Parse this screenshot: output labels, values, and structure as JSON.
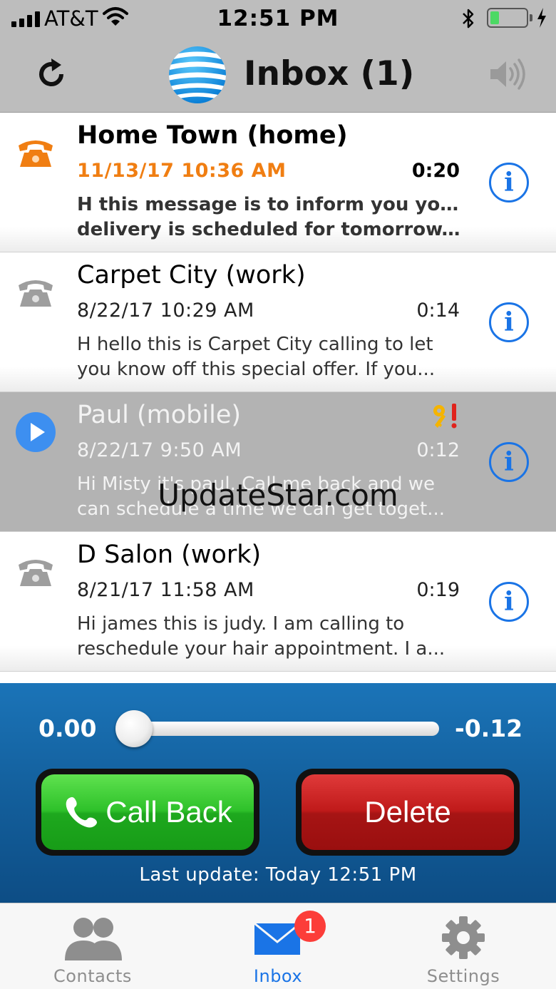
{
  "status_bar": {
    "carrier": "AT&T",
    "time": "12:51 PM"
  },
  "header": {
    "title": "Inbox (1)"
  },
  "messages": [
    {
      "name": "Home Town (home)",
      "date": "11/13/17 10:36 AM",
      "duration": "0:20",
      "preview_line1": "H this message is to inform you your",
      "preview_line2": "delivery is scheduled for tomorrow...",
      "unread": true,
      "icon": "phone-orange-icon"
    },
    {
      "name": "Carpet City (work)",
      "date": "8/22/17 10:29 AM",
      "duration": "0:14",
      "preview_line1": "H hello this is Carpet City calling to let",
      "preview_line2": "you know off this special offer. If you...",
      "unread": false,
      "icon": "phone-gray-icon"
    },
    {
      "name": "Paul (mobile)",
      "date": "8/22/17 9:50 AM",
      "duration": "0:12",
      "preview_line1": "Hi Misty it's paul. Call me back and we",
      "preview_line2": "can schedule a time we can get toget...",
      "unread": false,
      "selected": true,
      "icon": "play-icon"
    },
    {
      "name": "D Salon (work)",
      "date": "8/21/17 11:58 AM",
      "duration": "0:19",
      "preview_line1": "Hi james this is judy. I am calling to",
      "preview_line2": "reschedule your hair appointment. I a...",
      "unread": false,
      "icon": "phone-gray-icon"
    }
  ],
  "watermark": "UpdateStar.com",
  "player": {
    "elapsed": "0.00",
    "remaining": "-0.12",
    "progress": 0,
    "call_back_label": "Call Back",
    "delete_label": "Delete",
    "last_update": "Last update: Today 12:51 PM"
  },
  "tabs": [
    {
      "label": "Contacts",
      "icon": "contacts-icon"
    },
    {
      "label": "Inbox",
      "icon": "envelope-icon",
      "badge": "1"
    },
    {
      "label": "Settings",
      "icon": "gear-icon"
    }
  ],
  "colors": {
    "header_bg": "#bdbdbd",
    "unread_date": "#f07e12",
    "info_blue": "#1a74e6",
    "call_green": "#2ec12a",
    "delete_red": "#c01a1a",
    "player_bg": "#135f9c",
    "badge_red": "#fc3d39"
  }
}
